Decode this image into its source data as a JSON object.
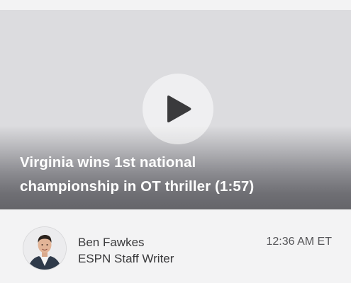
{
  "video": {
    "title_line1": "Virginia wins 1st national",
    "title_line2": "championship in OT thriller (1:57)",
    "play_icon": "play-icon"
  },
  "author": {
    "name": "Ben Fawkes",
    "role": "ESPN Staff Writer",
    "avatar_icon": "author-avatar"
  },
  "timestamp": "12:36 AM ET"
}
